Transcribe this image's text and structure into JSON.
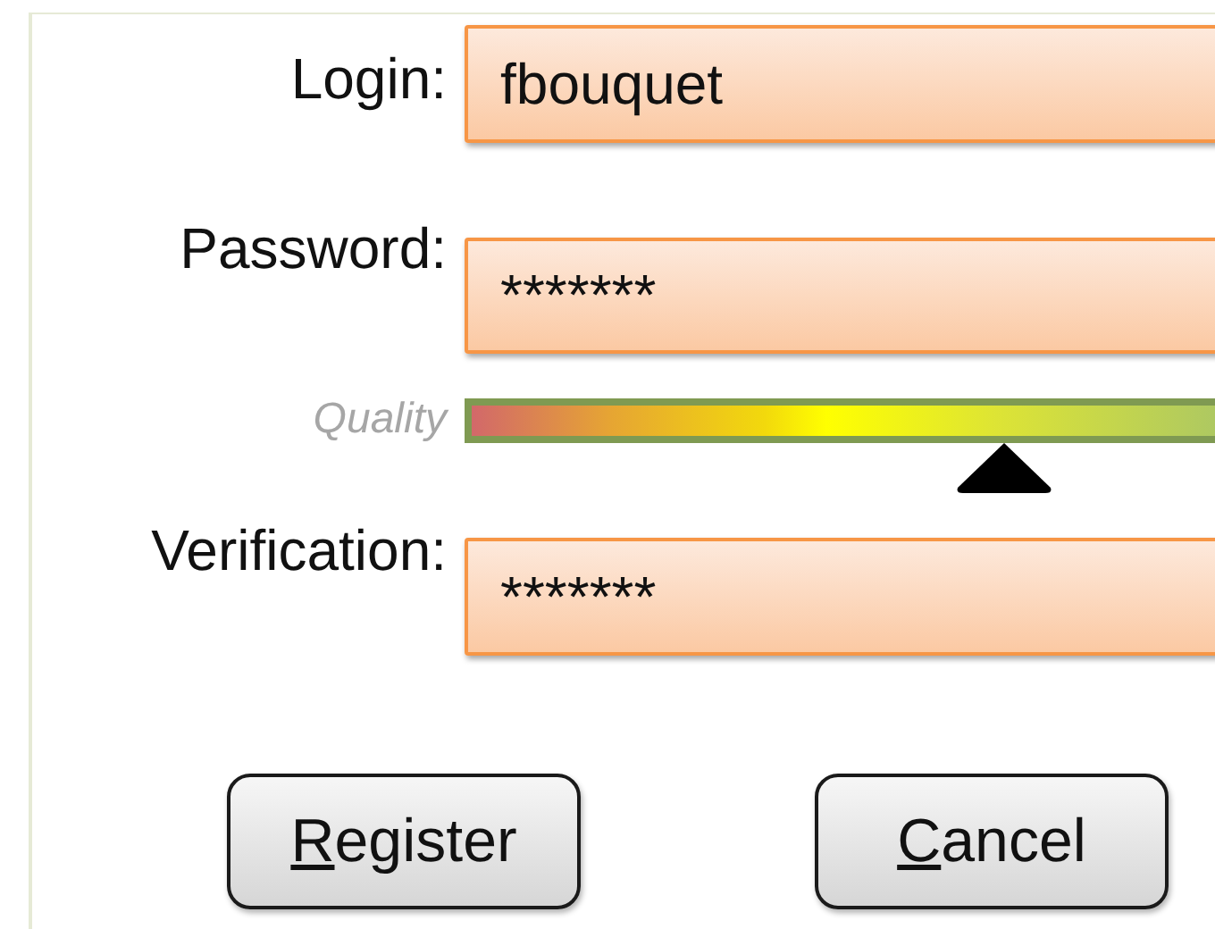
{
  "login": {
    "label": "Login:",
    "value": "fbouquet"
  },
  "password": {
    "label": "Password:",
    "value": "*******"
  },
  "quality": {
    "label": "Quality",
    "level": 0.69
  },
  "verification": {
    "label": "Verification:",
    "value": "*******"
  },
  "buttons": [
    {
      "label": "Register",
      "mnemonic_underlined": true
    },
    {
      "label": "Cancel",
      "mnemonic_underlined": true
    }
  ]
}
